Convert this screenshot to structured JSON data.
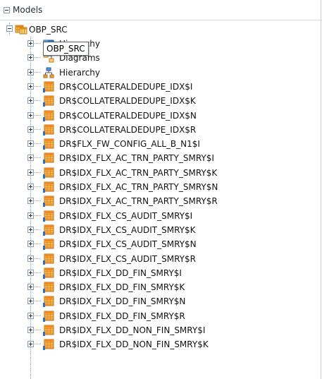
{
  "panel": {
    "title": "Models"
  },
  "tooltip": "OBP_SRC",
  "schema": {
    "label": "OBP_SRC"
  },
  "children": [
    {
      "label": "Hierarchy",
      "icon": "folder-icon"
    },
    {
      "label": "Diagrams",
      "icon": "diagram-icon"
    },
    {
      "label": "Hierarchy",
      "icon": "hierarchy-icon"
    }
  ],
  "tables": [
    "DR$COLLATERALDEDUPE_IDX$I",
    "DR$COLLATERALDEDUPE_IDX$K",
    "DR$COLLATERALDEDUPE_IDX$N",
    "DR$COLLATERALDEDUPE_IDX$R",
    "DR$FLX_FW_CONFIG_ALL_B_N1$I",
    "DR$IDX_FLX_AC_TRN_PARTY_SMRY$I",
    "DR$IDX_FLX_AC_TRN_PARTY_SMRY$K",
    "DR$IDX_FLX_AC_TRN_PARTY_SMRY$N",
    "DR$IDX_FLX_AC_TRN_PARTY_SMRY$R",
    "DR$IDX_FLX_CS_AUDIT_SMRY$I",
    "DR$IDX_FLX_CS_AUDIT_SMRY$K",
    "DR$IDX_FLX_CS_AUDIT_SMRY$N",
    "DR$IDX_FLX_CS_AUDIT_SMRY$R",
    "DR$IDX_FLX_DD_FIN_SMRY$I",
    "DR$IDX_FLX_DD_FIN_SMRY$K",
    "DR$IDX_FLX_DD_FIN_SMRY$N",
    "DR$IDX_FLX_DD_FIN_SMRY$R",
    "DR$IDX_FLX_DD_NON_FIN_SMRY$I",
    "DR$IDX_FLX_DD_NON_FIN_SMRY$K"
  ],
  "colors": {
    "table_orange": "#f08a1e",
    "table_blue": "#2e6fc3",
    "guide": "#9aa3ad"
  }
}
